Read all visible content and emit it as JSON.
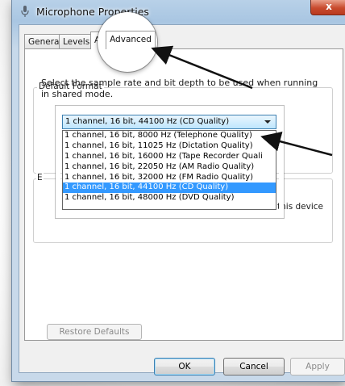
{
  "window": {
    "title": "Microphone Properties",
    "close_symbol": "x",
    "icon": "microphone-icon"
  },
  "tabs": [
    {
      "label": "General"
    },
    {
      "label": "Levels"
    },
    {
      "label": "Advanced",
      "active": true
    }
  ],
  "default_format": {
    "group_title": "Default Format",
    "description": "Select the sample rate and bit depth to be used when running in shared mode.",
    "selected_value": "1 channel, 16 bit, 44100 Hz (CD Quality)",
    "options": [
      "1 channel, 16 bit, 8000 Hz (Telephone Quality)",
      "1 channel, 16 bit, 11025 Hz (Dictation Quality)",
      "1 channel, 16 bit, 16000 Hz (Tape Recorder Quali",
      "1 channel, 16 bit, 22050 Hz (AM Radio Quality)",
      "1 channel, 16 bit, 32000 Hz (FM Radio Quality)",
      "1 channel, 16 bit, 44100 Hz (CD Quality)",
      "1 channel, 16 bit, 48000 Hz (DVD Quality)"
    ]
  },
  "exclusive": {
    "group_title_partial": "E",
    "partial_text": "this device"
  },
  "restore_defaults_label": "Restore Defaults",
  "footer": {
    "ok_label": "OK",
    "cancel_label": "Cancel",
    "apply_label": "Apply"
  },
  "colors": {
    "selection": "#3399ff",
    "close_button": "#c84a2d",
    "annotation_arrow": "#111111"
  }
}
